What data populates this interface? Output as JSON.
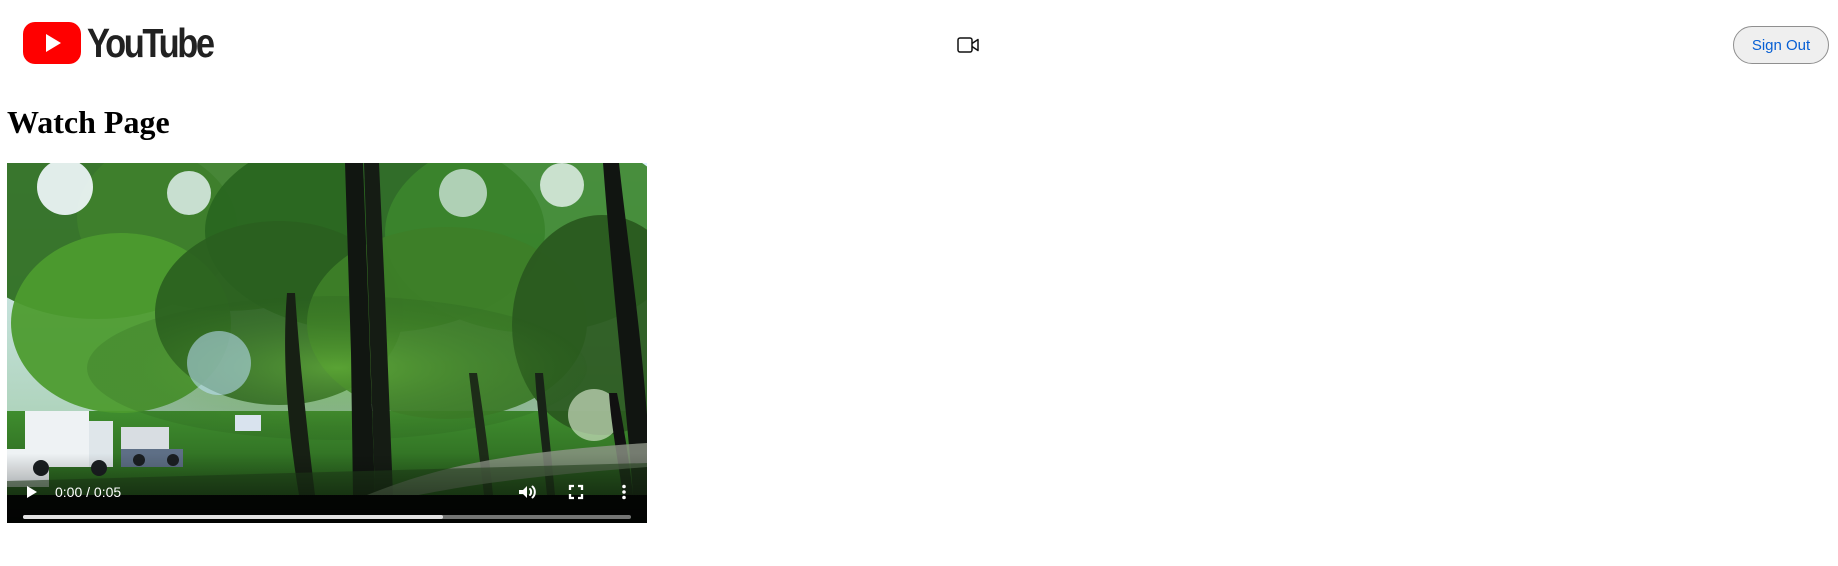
{
  "header": {
    "logo_text": "YouTube",
    "brand_color": "#ff0000",
    "upload_icon": "video-camera-icon",
    "sign_out_label": "Sign Out"
  },
  "page": {
    "title": "Watch Page"
  },
  "video": {
    "current_time": "0:00",
    "duration": "0:05",
    "time_display": "0:00 / 0:05",
    "buffered_fraction": 0.69,
    "icons": {
      "play": "play-icon",
      "volume": "volume-icon",
      "fullscreen": "fullscreen-icon",
      "more": "more-vertical-icon"
    }
  }
}
